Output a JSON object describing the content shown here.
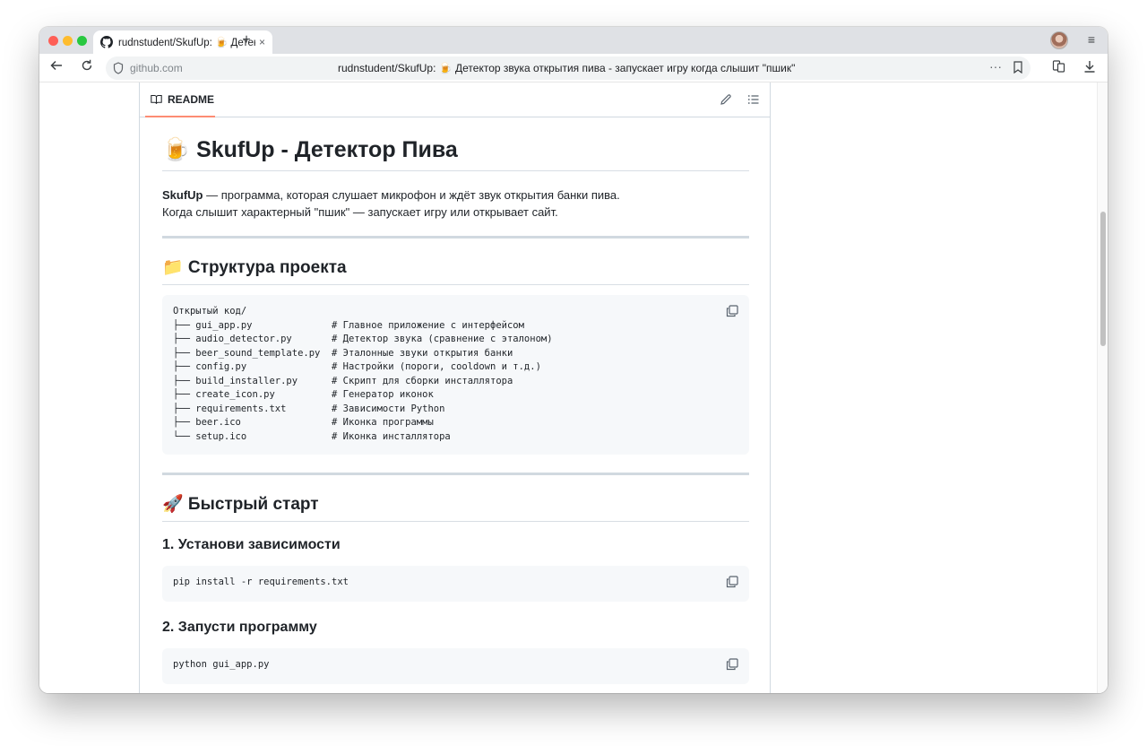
{
  "browser": {
    "tab_title": "rudnstudent/SkufUp: 🍺 Детектор з",
    "tab_close": "×",
    "new_tab": "+",
    "url_host": "github.com",
    "url_page_title": "rudnstudent/SkufUp: 🍺 Детектор звука открытия пива - запускает игру когда слышит \"пшик\"",
    "menu_glyph": "≡",
    "more_glyph": "···"
  },
  "readme": {
    "tab_label": "README",
    "title": "🍺 SkufUp - Детектор Пива",
    "intro_bold": "SkufUp",
    "intro_line1_rest": " — программа, которая слушает микрофон и ждёт звук открытия банки пива.",
    "intro_line2": "Когда слышит характерный \"пшик\" — запускает игру или открывает сайт.",
    "structure_heading": "📁 Структура проекта",
    "structure_code": "Открытый код/\n├── gui_app.py              # Главное приложение с интерфейсом\n├── audio_detector.py       # Детектор звука (сравнение с эталоном)\n├── beer_sound_template.py  # Эталонные звуки открытия банки\n├── config.py               # Настройки (пороги, cooldown и т.д.)\n├── build_installer.py      # Скрипт для сборки инсталлятора\n├── create_icon.py          # Генератор иконок\n├── requirements.txt        # Зависимости Python\n├── beer.ico                # Иконка программы\n└── setup.ico               # Иконка инсталлятора",
    "quickstart_heading": "🚀 Быстрый старт",
    "step1_heading": "1. Установи зависимости",
    "step1_code": "pip install -r requirements.txt",
    "step2_heading": "2. Запусти программу",
    "step2_code": "python gui_app.py"
  },
  "colors": {
    "tab_underline": "#fd8c73",
    "border": "#d1d9e0",
    "code_bg": "#f6f8fa"
  }
}
